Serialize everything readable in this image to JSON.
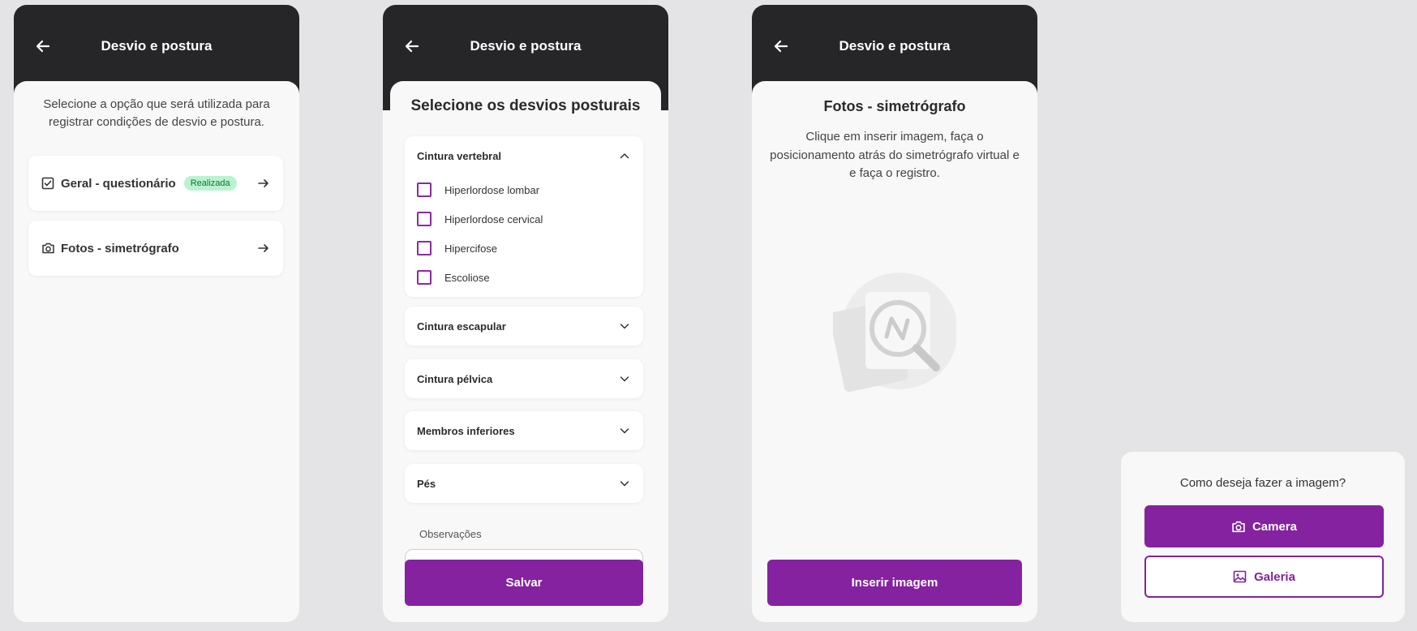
{
  "colors": {
    "header_bg": "#262628",
    "primary": "#8422a0",
    "badge_bg": "#b9f3cf",
    "badge_text": "#15703a",
    "page_bg": "#e4e4e6"
  },
  "screen1": {
    "header_title": "Desvio e postura",
    "intro": "Selecione a opção que será utilizada para registrar condições de desvio e postura.",
    "options": [
      {
        "label": "Geral - questionário",
        "badge": "Realizada",
        "icon": "checkbox-icon"
      },
      {
        "label": "Fotos - simetrógrafo",
        "icon": "camera-icon"
      }
    ]
  },
  "screen2": {
    "header_title": "Desvio e postura",
    "title": "Selecione os desvios posturais",
    "sections": [
      {
        "title": "Cintura vertebral",
        "expanded": true,
        "items": [
          "Hiperlordose lombar",
          "Hiperlordose cervical",
          "Hipercifose",
          "Escoliose"
        ]
      },
      {
        "title": "Cintura escapular",
        "expanded": false
      },
      {
        "title": "Cintura pélvica",
        "expanded": false
      },
      {
        "title": "Membros inferiores",
        "expanded": false
      },
      {
        "title": "Pés",
        "expanded": false
      }
    ],
    "observations_label": "Observações",
    "save_label": "Salvar"
  },
  "screen3": {
    "header_title": "Desvio e postura",
    "title": "Fotos - simetrógrafo",
    "description": "Clique em inserir imagem, faça o posicionamento atrás do simetrógrafo virtual e e faça o registro.",
    "insert_label": "Inserir imagem"
  },
  "image_sheet": {
    "question": "Como deseja fazer a imagem?",
    "camera_label": "Camera",
    "gallery_label": "Galeria"
  }
}
